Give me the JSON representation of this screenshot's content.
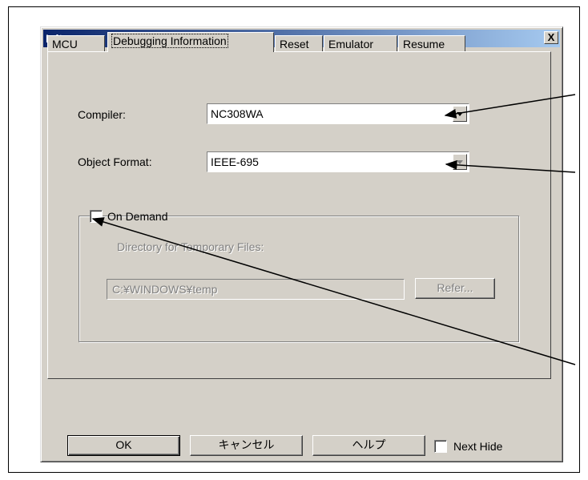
{
  "dialog": {
    "title": "Init",
    "close_label": "X"
  },
  "tabs": [
    {
      "label": "MCU"
    },
    {
      "label": "Debugging Information"
    },
    {
      "label": "Reset"
    },
    {
      "label": "Emulator"
    },
    {
      "label": "Resume"
    }
  ],
  "form": {
    "compiler_label": "Compiler:",
    "compiler_value": "NC308WA",
    "object_format_label": "Object Format:",
    "object_format_value": "IEEE-695",
    "on_demand_label": "On Demand",
    "temp_dir_label": "Directory for Temporary Files:",
    "temp_dir_value": "C:¥WINDOWS¥temp",
    "refer_label": "Refer..."
  },
  "footer": {
    "ok_label": "OK",
    "cancel_label": "キャンセル",
    "help_label": "ヘルプ",
    "next_hide_label": "Next Hide"
  },
  "icons": [
    "close-icon",
    "chevron-down-icon",
    "chevron-down-icon"
  ]
}
